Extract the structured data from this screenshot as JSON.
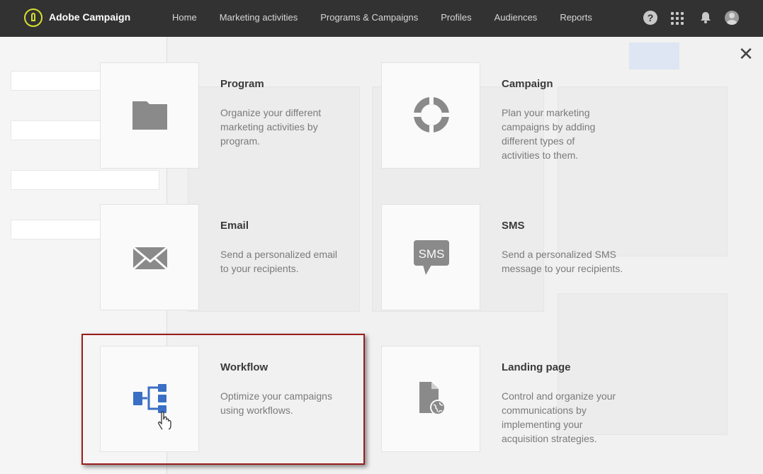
{
  "app": {
    "name": "Adobe Campaign"
  },
  "nav": [
    "Home",
    "Marketing activities",
    "Programs & Campaigns",
    "Profiles",
    "Audiences",
    "Reports"
  ],
  "topbar_icons": {
    "help": "?",
    "apps": "apps-grid-icon",
    "notifications": "bell-icon",
    "user": "avatar-icon"
  },
  "close_glyph": "✕",
  "tiles": [
    {
      "title": "Program",
      "desc": "Organize your different marketing activities by program.",
      "icon": "folder-icon"
    },
    {
      "title": "Campaign",
      "desc": "Plan your marketing campaigns by adding different types of activities to them.",
      "icon": "campaign-icon"
    },
    {
      "title": "Email",
      "desc": "Send a personalized email to your recipients.",
      "icon": "envelope-icon"
    },
    {
      "title": "SMS",
      "desc": "Send a personalized SMS message to your recipients.",
      "icon": "sms-icon",
      "icon_text": "SMS"
    },
    {
      "title": "Workflow",
      "desc": "Optimize your campaigns using workflows.",
      "icon": "workflow-icon",
      "highlighted": true
    },
    {
      "title": "Landing page",
      "desc": "Control and organize your communications by implementing your acquisition strategies.",
      "icon": "landing-page-icon"
    }
  ],
  "colors": {
    "topbar": "#323232",
    "accent": "#3a6fc4",
    "highlight_border": "#9b1c1c",
    "icon_gray": "#8a8a8a"
  }
}
